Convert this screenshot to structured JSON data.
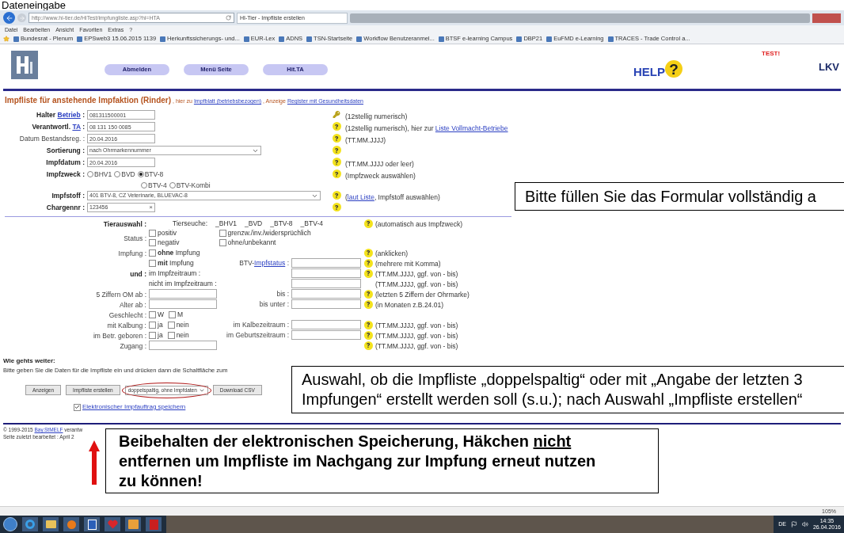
{
  "slide_title": "Dateneingabe",
  "browser": {
    "address": "http://www.hi-tier.de/HiTest/impfungliste.asp?hi=HTA",
    "tab": "HI-Tier - Impfliste erstellen",
    "menu": [
      "Datei",
      "Bearbeiten",
      "Ansicht",
      "Favoriten",
      "Extras",
      "?"
    ],
    "favorites": [
      "Bundesrat - Plenum",
      "EPSweb3 15.06.2015 1139",
      "Herkunftssicherungs- und...",
      "EUR-Lex",
      "ADNS",
      "TSN-Startseite",
      "Workflow Benutzeranmel...",
      "BTSF e-learning Campus",
      "DBP21",
      "EuFMD e-Learning",
      "TRACES - Trade Control a..."
    ]
  },
  "header": {
    "nav_buttons": [
      "Abmelden",
      "Menü Seite",
      "Hit.TA"
    ],
    "help": "HELP?",
    "test_label": "TEST!",
    "logo_right": "LKV"
  },
  "form_title": "Impfliste für anstehende Impfaktion (Rinder)",
  "title_links": [
    {
      "prefix": ", hier zu",
      "link": "Impfblatt (betriebsbezogen)"
    },
    {
      "prefix": ", Anzeige",
      "link": "Register mit Gesundheitsdaten"
    }
  ],
  "top_rows": [
    {
      "label": "Halter",
      "label_link": "Betrieb",
      "bold": true,
      "kind": "text",
      "value": "081311500001",
      "hint": [
        {
          "text": "(12stellig numerisch)"
        }
      ]
    },
    {
      "label": "Verantwortl.",
      "label_link": "TA",
      "bold": true,
      "kind": "text",
      "value": "08 131 150 0085",
      "hint": [
        {
          "text": "(12stellig numerisch), hier zur "
        },
        {
          "link": "Liste Vollmacht-Betriebe"
        }
      ]
    },
    {
      "label": "Datum Bestandsreg.",
      "bold": false,
      "kind": "text",
      "value": "20.04.2016",
      "hint": [
        {
          "text": "(TT.MM.JJJJ)"
        }
      ]
    },
    {
      "label": "Sortierung",
      "bold": true,
      "kind": "select",
      "value": "nach Ohrmarkennummer"
    },
    {
      "label": "Impfdatum",
      "bold": true,
      "kind": "text",
      "value": "20.04.2016",
      "hint": [
        {
          "text": "(TT.MM.JJJJ oder leer)"
        }
      ]
    },
    {
      "label": "Impfzweck",
      "bold": true,
      "kind": "radio",
      "options": [
        {
          "label": "BHV1",
          "selected": false
        },
        {
          "label": "BVD",
          "selected": false
        },
        {
          "label": "BTV-8",
          "selected": true
        },
        {
          "label": "BTV-4",
          "selected": false
        },
        {
          "label": "BTV-Kombi",
          "selected": false
        }
      ],
      "hint": [
        {
          "text": "(Impfzweck auswählen)"
        }
      ]
    },
    {
      "label": "Impfstoff",
      "bold": true,
      "kind": "select",
      "value": "401 BTV-8, CZ Veterinarie, BLUEVAC-8",
      "hint": [
        {
          "text": "("
        },
        {
          "link": "laut Liste"
        },
        {
          "text": ", Impfstoff auswählen)"
        }
      ]
    },
    {
      "label": "Chargennr",
      "bold": true,
      "kind": "combo",
      "value": "123456",
      "clear": "×"
    }
  ],
  "lower_rows": [
    {
      "label": "Tierauswahl :",
      "bold": true,
      "kind": "tierseuche",
      "text": "Tierseuche:",
      "items": [
        "_BHV1",
        "_BVD",
        "_BTV-8",
        "_BTV-4"
      ],
      "help": true,
      "hint": "(automatisch aus Impfzweck)"
    },
    {
      "label": "Status :",
      "bold": false,
      "kind": "checks",
      "checks": [
        {
          "label": "positiv",
          "checked": false
        },
        {
          "label": "grenzw./inv./widersprüchlich",
          "checked": false
        },
        {
          "label": "negativ",
          "checked": false
        },
        {
          "label": "ohne/unbekannt",
          "checked": false
        }
      ],
      "help": false
    },
    {
      "label": "Impfung :",
      "bold": false,
      "kind": "checks",
      "checks": [
        {
          "label": "**ohne** Impfung",
          "checked": false
        }
      ],
      "help": true,
      "hint": "(anklicken)"
    },
    {
      "kind": "checks",
      "checks": [
        {
          "label": "**mit** Impfung",
          "checked": false
        }
      ],
      "mid": "BTV-",
      "mid_link": "Impfstatus",
      "mid_suffix": " :",
      "input": true,
      "help": true,
      "hint": "(mehrere mit Komma)"
    },
    {
      "label": "und :",
      "bold": true,
      "kind": "text",
      "text": "im Impfzeitraum :",
      "input": true,
      "help": true,
      "hint": "(TT.MM.JJJJ, ggf. von - bis)"
    },
    {
      "kind": "text",
      "text": "nicht im Impfzeitraum :",
      "input": true,
      "help": false,
      "hint": "(TT.MM.JJJJ, ggf. von - bis)"
    },
    {
      "label": "5 Ziffern OM ab :",
      "bold": false,
      "kind": "input",
      "mid": "bis :",
      "input": true,
      "help": true,
      "hint": "(letzten 5 Ziffern der Ohrmarke)"
    },
    {
      "label": "Alter ab :",
      "bold": false,
      "kind": "input",
      "mid": "bis unter :",
      "input": true,
      "help": true,
      "hint": "(in Monaten z.B.24.01)"
    },
    {
      "label": "Geschlecht :",
      "bold": false,
      "kind": "checks",
      "checks": [
        {
          "label": "W",
          "checked": false
        },
        {
          "label": "M",
          "checked": false
        }
      ],
      "help": false
    },
    {
      "label": "mit Kalbung :",
      "bold": false,
      "kind": "checks",
      "checks": [
        {
          "label": "ja",
          "checked": false
        },
        {
          "label": "nein",
          "checked": false
        }
      ],
      "mid": "im Kalbezeitraum :",
      "input": true,
      "help": true,
      "hint": "(TT.MM.JJJJ, ggf. von - bis)"
    },
    {
      "label": "im Betr. geboren :",
      "bold": false,
      "kind": "checks",
      "checks": [
        {
          "label": "ja",
          "checked": false
        },
        {
          "label": "nein",
          "checked": false
        }
      ],
      "mid": "im Geburtszeitraum :",
      "input": true,
      "help": true,
      "hint": "(TT.MM.JJJJ, ggf. von - bis)"
    },
    {
      "label": "Zugang :",
      "bold": false,
      "kind": "input",
      "help": true,
      "hint": "(TT.MM.JJJJ, ggf. von - bis)"
    }
  ],
  "next": {
    "heading": "Wie gehts weiter:",
    "text": "Bitte geben Sie die Daten für die Impfliste ein und drücken dann die Schaltfläche zum"
  },
  "actions": [
    {
      "kind": "button",
      "label": "Anzeigen"
    },
    {
      "kind": "button",
      "label": "Impfliste erstellen"
    },
    {
      "kind": "select",
      "label": "doppelspaltig, ohne Impfdaten"
    },
    {
      "kind": "button",
      "label": "Download CSV"
    }
  ],
  "save_option": {
    "label": "Elektronischer Impfauftrag speichern",
    "checked": true
  },
  "footer": [
    {
      "text": "© 1999-2015 ",
      "link": "Bay.StMELF",
      "after": " verantw"
    },
    {
      "text": "Seite zuletzt bearbeitet : April 2"
    }
  ],
  "status_bar": {
    "zoom": "105%"
  },
  "taskbar": {
    "language": "DE",
    "time": "14:35",
    "date": "26.04.2016"
  },
  "callouts": [
    {
      "kind": "plain",
      "parts": [
        {
          "text": "Bitte füllen Sie das Formular vollständig a"
        }
      ]
    },
    {
      "kind": "plain",
      "parts": [
        {
          "text": "Auswahl, ob die Impfliste „doppelspaltig“ oder mit „Angabe der letzten 3 Impfungen“ erstellt werden soll (s.u.); nach Auswahl „Impfliste erstellen“"
        }
      ]
    },
    {
      "kind": "bold",
      "parts": [
        {
          "text": "Beibehalten der elektronischen Speicherung, Häkchen "
        },
        {
          "text": "nicht",
          "underline": true
        },
        {
          "text": " entfernen um Impfliste im Nachgang zur Impfung erneut nutzen zu können!"
        }
      ]
    }
  ]
}
